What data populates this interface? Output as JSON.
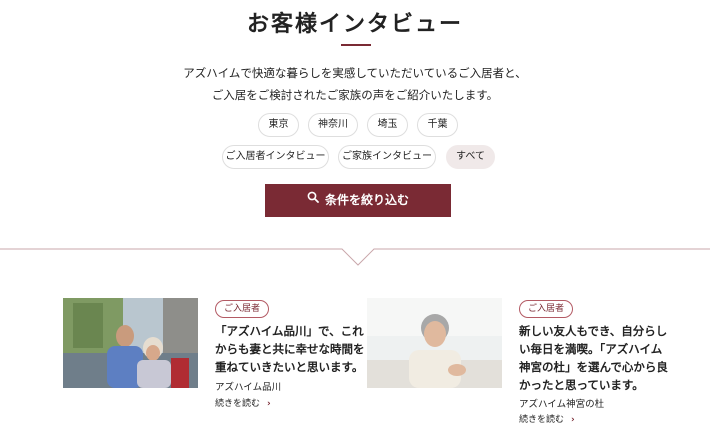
{
  "page": {
    "title": "お客様インタビュー",
    "intro_line1": "アズハイムで快適な暮らしを実感していただいているご入居者と、",
    "intro_line2": "ご入居をご検討されたご家族の声をご紹介いたします。"
  },
  "filters": {
    "regions": [
      "東京",
      "神奈川",
      "埼玉",
      "千葉"
    ],
    "types": [
      "ご入居者インタビュー",
      "ご家族インタビュー",
      "すべて"
    ],
    "active_type": "すべて",
    "submit_label": "条件を絞り込む",
    "submit_icon": "search-icon"
  },
  "cards": [
    {
      "badge": "ご入居者",
      "title_lines": [
        "「アズハイム品川」で、これ",
        "からも妻と共に幸せな時間を",
        "重ねていきたいと思います。"
      ],
      "place": "アズハイム品川",
      "more": "続きを読む",
      "image": "elderly-couple-photo"
    },
    {
      "badge": "ご入居者",
      "title_lines": [
        "新しい友人もでき、自分らし",
        "い毎日を満喫。「アズハイム",
        "神宮の杜」を選んで心から良",
        "かったと思っています。"
      ],
      "place": "アズハイム神宮の杜",
      "more": "続きを読む",
      "image": "elderly-woman-photo"
    }
  ],
  "colors": {
    "accent": "#7a2a34",
    "chip_active_bg": "#f0e9e9",
    "chip_border": "#dedede"
  }
}
